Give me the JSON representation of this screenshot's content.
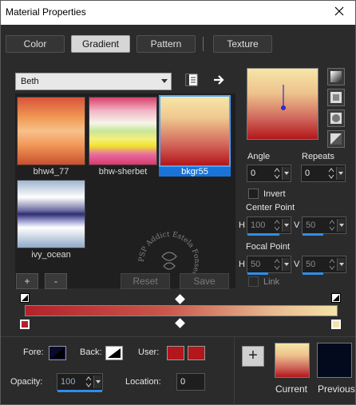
{
  "window": {
    "title": "Material Properties"
  },
  "tabs": [
    {
      "label": "Color"
    },
    {
      "label": "Gradient"
    },
    {
      "label": "Pattern"
    },
    {
      "label": "Texture"
    }
  ],
  "gradient_panel": {
    "category": "Beth",
    "swatches": [
      {
        "label": "bhw4_77"
      },
      {
        "label": "bhw-sherbet"
      },
      {
        "label": "bkgr55"
      },
      {
        "label": "ivy_ocean"
      }
    ],
    "watermark_text": "PSP Addict Estela Fonseca",
    "buttons": {
      "add": "+",
      "remove": "-",
      "reset": "Reset",
      "save": "Save"
    }
  },
  "settings": {
    "angle_label": "Angle",
    "angle_value": "0",
    "repeats_label": "Repeats",
    "repeats_value": "0",
    "invert_label": "Invert",
    "center_point_label": "Center Point",
    "center_h_label": "H",
    "center_h_value": "100",
    "center_v_label": "V",
    "center_v_value": "50",
    "focal_point_label": "Focal Point",
    "focal_h_label": "H",
    "focal_h_value": "50",
    "focal_v_label": "V",
    "focal_v_value": "50",
    "link_label": "Link"
  },
  "bottom": {
    "fore_label": "Fore:",
    "back_label": "Back:",
    "user_label": "User:",
    "opacity_label": "Opacity:",
    "opacity_value": "100",
    "location_label": "Location:",
    "location_value": "0",
    "current_label": "Current",
    "previous_label": "Previous",
    "plus": "+"
  },
  "colors": {
    "accent": "#1a73d9",
    "user_color": "#b3161b",
    "gradient_start": "#b3222a",
    "gradient_end": "#f5e2a6",
    "previous_color": "#040a1e"
  },
  "icons": {
    "close": "close-icon",
    "book": "book-icon",
    "arrow_right": "arrow-right-icon",
    "style_linear": "linear-style-icon",
    "style_rect": "rectangular-style-icon",
    "style_sunburst": "sunburst-style-icon",
    "style_radial": "radial-style-icon"
  }
}
